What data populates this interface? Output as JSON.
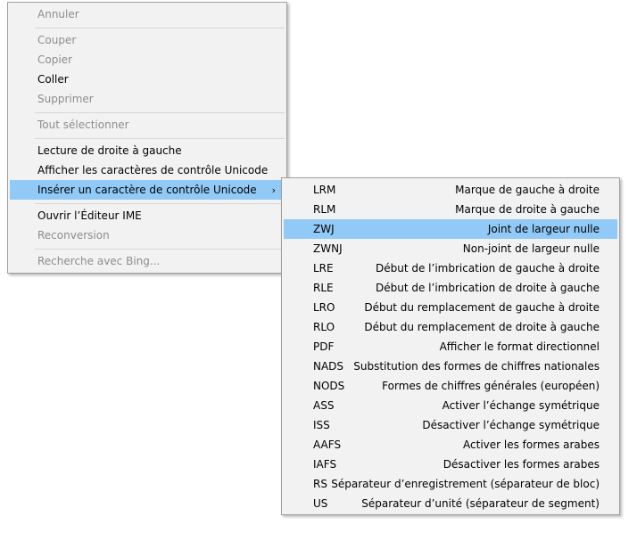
{
  "main_menu": {
    "items": [
      {
        "label": "Annuler",
        "disabled": true
      },
      {
        "label": "Couper",
        "disabled": true
      },
      {
        "label": "Copier",
        "disabled": true
      },
      {
        "label": "Coller",
        "disabled": false
      },
      {
        "label": "Supprimer",
        "disabled": true
      },
      {
        "label": "Tout sélectionner",
        "disabled": true
      },
      {
        "label": "Lecture de droite à gauche",
        "disabled": false
      },
      {
        "label": "Afficher les caractères de contrôle Unicode",
        "disabled": false
      },
      {
        "label": "Insérer un caractère de contrôle Unicode",
        "disabled": false,
        "submenu_arrow": "›"
      },
      {
        "label": "Ouvrir l’Éditeur IME",
        "disabled": false
      },
      {
        "label": "Reconversion",
        "disabled": true
      },
      {
        "label": "Recherche avec Bing...",
        "disabled": true
      }
    ]
  },
  "submenu": {
    "items": [
      {
        "code": "LRM",
        "desc": "Marque de gauche à droite"
      },
      {
        "code": "RLM",
        "desc": "Marque de droite à gauche"
      },
      {
        "code": "ZWJ",
        "desc": "Joint de largeur nulle"
      },
      {
        "code": "ZWNJ",
        "desc": "Non-joint de largeur nulle"
      },
      {
        "code": "LRE",
        "desc": "Début de l’imbrication de gauche à droite"
      },
      {
        "code": "RLE",
        "desc": "Début de l’imbrication de droite à gauche"
      },
      {
        "code": "LRO",
        "desc": "Début du remplacement de gauche à droite"
      },
      {
        "code": "RLO",
        "desc": "Début du remplacement de droite à gauche"
      },
      {
        "code": "PDF",
        "desc": "Afficher le format directionnel"
      },
      {
        "code": "NADS",
        "desc": "Substitution des formes de chiffres nationales"
      },
      {
        "code": "NODS",
        "desc": "Formes de chiffres générales (européen)"
      },
      {
        "code": "ASS",
        "desc": "Activer l’échange symétrique"
      },
      {
        "code": "ISS",
        "desc": "Désactiver l’échange symétrique"
      },
      {
        "code": "AAFS",
        "desc": "Activer les formes arabes"
      },
      {
        "code": "IAFS",
        "desc": "Désactiver les formes arabes"
      },
      {
        "code": "RS",
        "desc": "Séparateur d’enregistrement (séparateur de bloc)"
      },
      {
        "code": "US",
        "desc": "Séparateur d’unité (séparateur de segment)"
      }
    ]
  },
  "colors": {
    "highlight": "#91c9f7",
    "disabled_text": "#8d8d8d",
    "menu_bg": "#f2f2f2"
  }
}
